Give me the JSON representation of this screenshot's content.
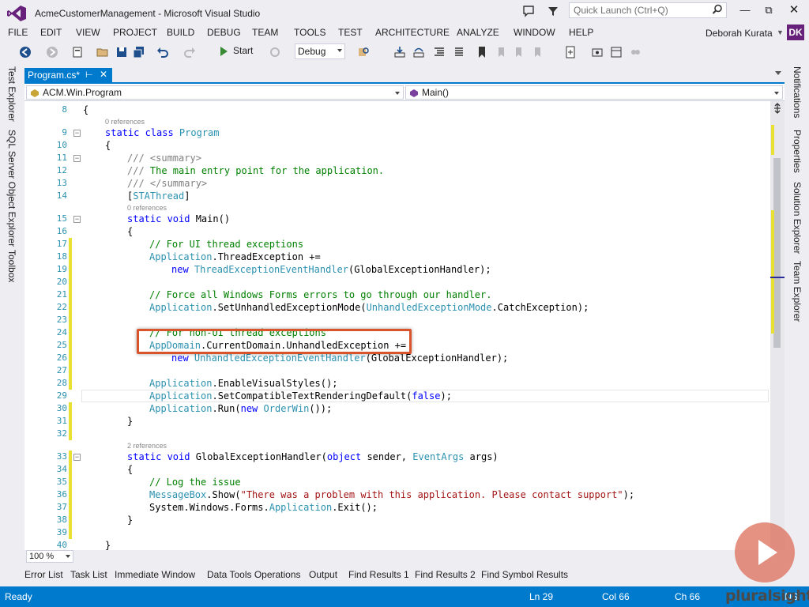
{
  "app": {
    "title": "AcmeCustomerManagement - Microsoft Visual Studio",
    "quick_launch_placeholder": "Quick Launch (Ctrl+Q)",
    "user": "Deborah Kurata",
    "avatar": "DK"
  },
  "menu": [
    "FILE",
    "EDIT",
    "VIEW",
    "PROJECT",
    "BUILD",
    "DEBUG",
    "TEAM",
    "TOOLS",
    "TEST",
    "ARCHITECTURE",
    "ANALYZE",
    "WINDOW",
    "HELP"
  ],
  "toolbar": {
    "start": "Start",
    "config": "Debug"
  },
  "left_tabs": [
    "Test Explorer",
    "SQL Server Object Explorer",
    "Toolbox"
  ],
  "right_tabs": [
    "Notifications",
    "Properties",
    "Solution Explorer",
    "Team Explorer"
  ],
  "doc_tab": "Program.cs*",
  "nav": {
    "class": "ACM.Win.Program",
    "member": "Main()"
  },
  "refs": {
    "zero": "0 references",
    "two": "2 references"
  },
  "code": {
    "l8": "{",
    "l9a": "static class ",
    "l9b": "Program",
    "l10": "{",
    "l11a": "/// ",
    "l11b": "<summary>",
    "l12a": "///",
    "l12b": " The main entry point for the application.",
    "l13a": "/// ",
    "l13b": "</summary>",
    "l14a": "[",
    "l14b": "STAThread",
    "l14c": "]",
    "l15a": "static void ",
    "l15b": "Main()",
    "l16": "{",
    "l17": "// For UI thread exceptions",
    "l18a": "Application",
    "l18b": ".ThreadException +=",
    "l19a": "new ",
    "l19b": "ThreadExceptionEventHandler",
    "l19c": "(GlobalExceptionHandler);",
    "l21": "// Force all Windows Forms errors to go through our handler.",
    "l22a": "Application",
    "l22b": ".SetUnhandledExceptionMode(",
    "l22c": "UnhandledExceptionMode",
    "l22d": ".CatchException);",
    "l24": "// For non-UI thread exceptions",
    "l25a": "AppDomain",
    "l25b": ".CurrentDomain.UnhandledException +=",
    "l26a": "new ",
    "l26b": "UnhandledExceptionEventHandler",
    "l26c": "(GlobalExceptionHandler);",
    "l28a": "Application",
    "l28b": ".EnableVisualStyles();",
    "l29a": "Application",
    "l29b": ".SetCompatibleTextRenderingDefault(",
    "l29c": "false",
    "l29d": ");",
    "l30a": "Application",
    "l30b": ".Run(",
    "l30c": "new ",
    "l30d": "OrderWin",
    "l30e": "());",
    "l31": "}",
    "l33a": "static void ",
    "l33b": "GlobalExceptionHandler(",
    "l33c": "object",
    "l33d": " sender, ",
    "l33e": "EventArgs",
    "l33f": " args)",
    "l34": "{",
    "l35": "// Log the issue",
    "l36a": "MessageBox",
    "l36b": ".Show(",
    "l36c": "\"There was a problem with this application. Please contact support\"",
    "l36d": ");",
    "l37a": "System.Windows.Forms.",
    "l37b": "Application",
    "l37c": ".Exit();",
    "l38": "}",
    "l40": "}"
  },
  "zoom": "100 %",
  "bottom_tabs": [
    "Error List",
    "Task List",
    "Immediate Window",
    "Data Tools Operations",
    "Output",
    "Find Results 1",
    "Find Results 2",
    "Find Symbol Results"
  ],
  "status": {
    "ready": "Ready",
    "ln": "Ln 29",
    "col": "Col 66",
    "ch": "Ch 66",
    "ins": "INS"
  },
  "brand": "pluralsight",
  "colors": {
    "accent": "#007acc",
    "highlight": "#d9542b",
    "vs_purple": "#68217a"
  }
}
